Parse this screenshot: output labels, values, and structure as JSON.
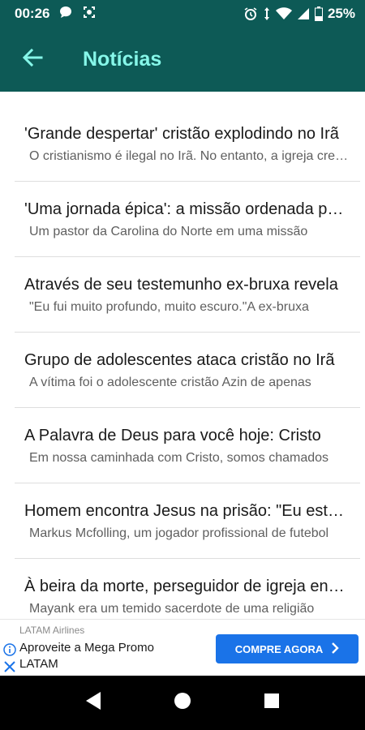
{
  "status_bar": {
    "time": "00:26",
    "battery": "25%",
    "icons": [
      "chat-bubble-icon",
      "screenshot-icon",
      "alarm-icon",
      "data-arrows-icon",
      "wifi-icon",
      "signal-icon",
      "battery-icon"
    ]
  },
  "app_bar": {
    "title": "Notícias",
    "back_icon": "arrow-back-icon"
  },
  "news": [
    {
      "title": "'Grande despertar' cristão explodindo no Irã",
      "snippet": "O cristianismo é ilegal no Irã. No entanto, a igreja cresce"
    },
    {
      "title": "'Uma jornada épica': a missão ordenada por Deus",
      "snippet": "Um pastor da Carolina do Norte em uma missão"
    },
    {
      "title": "Através de seu testemunho ex-bruxa revela",
      "snippet": "\"Eu fui muito profundo, muito escuro.\"A ex-bruxa"
    },
    {
      "title": "Grupo de adolescentes ataca cristão no Irã",
      "snippet": "A vítima foi o adolescente cristão Azin de apenas"
    },
    {
      "title": "A Palavra de Deus para você hoje: Cristo",
      "snippet": "Em nossa caminhada com Cristo, somos chamados"
    },
    {
      "title": "Homem encontra Jesus na prisão: \"Eu estava",
      "snippet": "Markus Mcfolling, um jogador profissional de futebol"
    },
    {
      "title": "À beira da morte, perseguidor de igreja encontra",
      "snippet": "Mayank era um temido sacerdote de uma religião"
    }
  ],
  "ad": {
    "sponsor": "LATAM Airlines",
    "text": "Aproveite a Mega Promo LATAM",
    "cta": "COMPRE AGORA",
    "accent": "#1a73e8"
  },
  "colors": {
    "primary": "#0d5a56",
    "title_accent": "#86f7e9"
  }
}
